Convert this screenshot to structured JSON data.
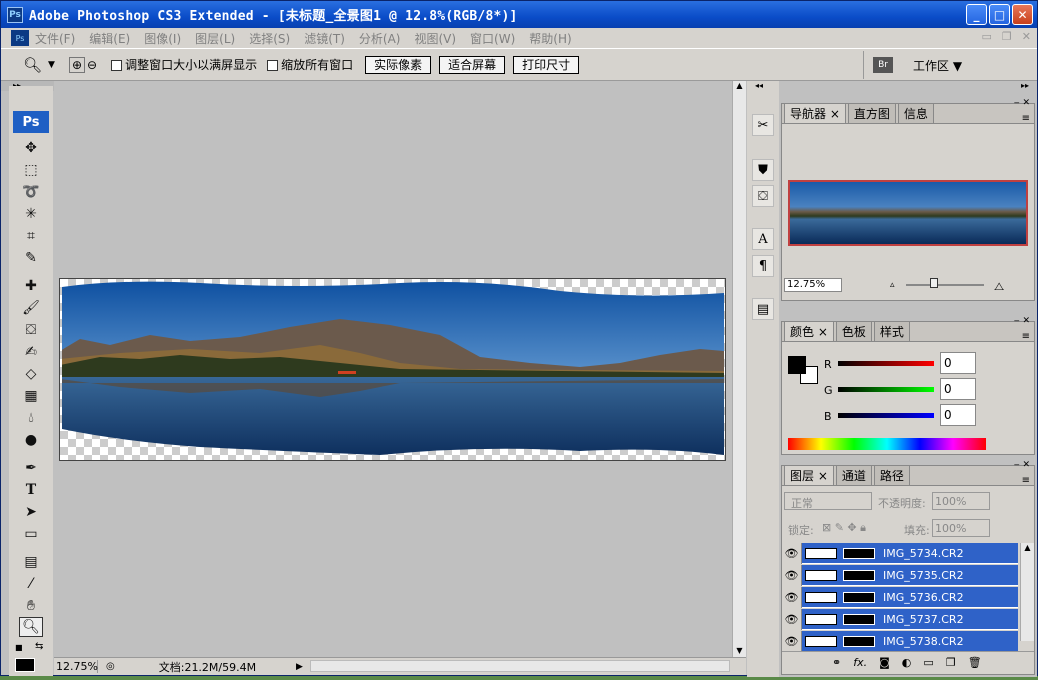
{
  "titlebar": {
    "title": "Adobe Photoshop CS3 Extended - [未标题_全景图1 @ 12.8%(RGB/8*)]",
    "logo": "Ps"
  },
  "menu": [
    "文件(F)",
    "编辑(E)",
    "图像(I)",
    "图层(L)",
    "选择(S)",
    "滤镜(T)",
    "分析(A)",
    "视图(V)",
    "窗口(W)",
    "帮助(H)"
  ],
  "options": {
    "resize_windows": "调整窗口大小以满屏显示",
    "zoom_all": "缩放所有窗口",
    "actual_pixels": "实际像素",
    "fit_screen": "适合屏幕",
    "print_size": "打印尺寸",
    "workspace": "工作区 ▼",
    "bridge": "Br"
  },
  "toolbox": {
    "logo": "Ps"
  },
  "status": {
    "zoom": "12.75%",
    "doc": "文档:21.2M/59.4M"
  },
  "navigator": {
    "tabs": [
      "导航器 ×",
      "直方图",
      "信息"
    ],
    "zoom": "12.75%"
  },
  "color": {
    "tabs": [
      "颜色 ×",
      "色板",
      "样式"
    ],
    "r_label": "R",
    "g_label": "G",
    "b_label": "B",
    "r": "0",
    "g": "0",
    "b": "0"
  },
  "layers": {
    "tabs": [
      "图层 ×",
      "通道",
      "路径"
    ],
    "blend_mode": "正常",
    "opacity_label": "不透明度:",
    "opacity": "100%",
    "lock_label": "锁定:",
    "fill_label": "填充:",
    "fill": "100%",
    "items": [
      "IMG_5734.CR2",
      "IMG_5735.CR2",
      "IMG_5736.CR2",
      "IMG_5737.CR2",
      "IMG_5738.CR2"
    ]
  }
}
